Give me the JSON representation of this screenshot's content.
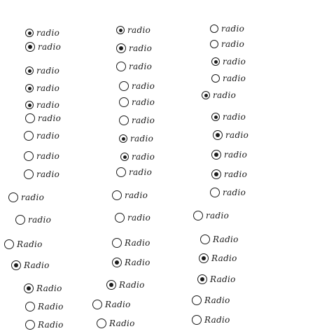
{
  "sheet": {
    "options": [
      {
        "label": "radio",
        "selected": true
      },
      {
        "label": "radio",
        "selected": true
      },
      {
        "label": "radio",
        "selected": true
      },
      {
        "label": "radio",
        "selected": true
      },
      {
        "label": "radio",
        "selected": true
      },
      {
        "label": "radio",
        "selected": false
      },
      {
        "label": "radio",
        "selected": false
      },
      {
        "label": "radio",
        "selected": false
      },
      {
        "label": "radio",
        "selected": false
      },
      {
        "label": "radio",
        "selected": false
      },
      {
        "label": "radio",
        "selected": false
      },
      {
        "label": "Radio",
        "selected": false
      },
      {
        "label": "Radio",
        "selected": true
      },
      {
        "label": "Radio",
        "selected": true
      },
      {
        "label": "Radio",
        "selected": false
      },
      {
        "label": "Radio",
        "selected": false
      },
      {
        "label": "radio",
        "selected": true
      },
      {
        "label": "radio",
        "selected": true
      },
      {
        "label": "radio",
        "selected": false
      },
      {
        "label": "radio",
        "selected": false
      },
      {
        "label": "radio",
        "selected": false
      },
      {
        "label": "radio",
        "selected": false
      },
      {
        "label": "radio",
        "selected": true
      },
      {
        "label": "radio",
        "selected": true
      },
      {
        "label": "radio",
        "selected": false
      },
      {
        "label": "radio",
        "selected": false
      },
      {
        "label": "radio",
        "selected": false
      },
      {
        "label": "Radio",
        "selected": false
      },
      {
        "label": "Radio",
        "selected": true
      },
      {
        "label": "Radio",
        "selected": true
      },
      {
        "label": "Radio",
        "selected": false
      },
      {
        "label": "Radio",
        "selected": false
      },
      {
        "label": "radio",
        "selected": false
      },
      {
        "label": "radio",
        "selected": false
      },
      {
        "label": "radio",
        "selected": true
      },
      {
        "label": "radio",
        "selected": false
      },
      {
        "label": "radio",
        "selected": true
      },
      {
        "label": "radio",
        "selected": true
      },
      {
        "label": "radio",
        "selected": true
      },
      {
        "label": "radio",
        "selected": true
      },
      {
        "label": "radio",
        "selected": true
      },
      {
        "label": "radio",
        "selected": false
      },
      {
        "label": "radio",
        "selected": false
      },
      {
        "label": "Radio",
        "selected": false
      },
      {
        "label": "Radio",
        "selected": true
      },
      {
        "label": "Radio",
        "selected": true
      },
      {
        "label": "Radio",
        "selected": false
      },
      {
        "label": "Radio",
        "selected": false
      }
    ]
  }
}
